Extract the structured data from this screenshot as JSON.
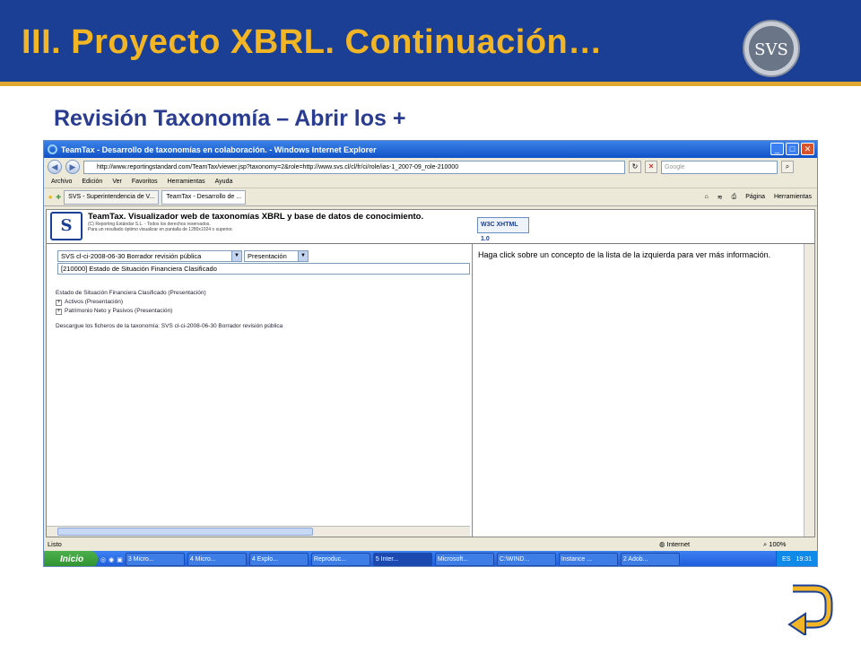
{
  "slide": {
    "title": "III. Proyecto XBRL. Continuación…",
    "subtitle": "Revisión Taxonomía – Abrir los +",
    "logo_text": "SVS",
    "colors": {
      "header_bg": "#1a3f94",
      "title": "#f2b526",
      "subtitle": "#2a3c8f"
    }
  },
  "browser": {
    "window_title": "TeamTax - Desarrollo de taxonomías en colaboración. - Windows Internet Explorer",
    "url": "http://www.reportingstandard.com/TeamTax/viewer.jsp?taxonomy=2&role=http://www.svs.cl/cl/fr/ci/role/ias-1_2007-09_role-210000",
    "search_placeholder": "Google",
    "menu": [
      "Archivo",
      "Edición",
      "Ver",
      "Favoritos",
      "Herramientas",
      "Ayuda"
    ],
    "tabs": [
      "SVS - Superintendencia de V...",
      "TeamTax - Desarrollo de ..."
    ],
    "page_btn": "Página",
    "tools_btn": "Herramientas",
    "status": "Listo",
    "zone": "Internet",
    "zoom": "100%"
  },
  "page": {
    "banner_title": "TeamTax. Visualizador web de taxonomías XBRL y base de datos de conocimiento.",
    "banner_small_1": "(C) Reporting Estándar S.L. - Todos los derechos reservados.",
    "banner_small_2": "Para un resultado óptimo visualizar en pantalla de 1280x1024 o superior.",
    "w3c_label": "W3C XHTML 1.0",
    "taxonomy_select": "SVS cl-ci-2008-06-30 Borrador revisión pública",
    "view_select": "Presentación",
    "role": "[210000] Estado de Situación Financiera Clasificado",
    "tree_root": "Estado de Situación Financiera Clasificado (Presentación)",
    "tree_children": [
      "Activos (Presentación)",
      "Patrimonio Neto y Pasivos (Presentación)"
    ],
    "download_text": "Descargue los ficheros de la taxonomía: SVS cl-ci-2008-06-30 Borrador revisión pública",
    "right_message": "Haga click sobre un concepto de la lista de la izquierda para ver más información."
  },
  "taskbar": {
    "start": "Inicio",
    "tasks": [
      "3 Micro...",
      "4 Micro...",
      "4 Explo...",
      "Reproduc...",
      "5 Inter...",
      "Microsoft...",
      "C:\\WIND...",
      "Instance ...",
      "2 Adob..."
    ],
    "lang": "ES",
    "clock": "19:31"
  }
}
